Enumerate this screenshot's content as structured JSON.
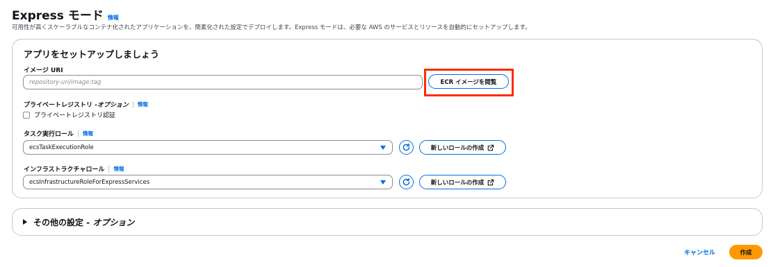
{
  "header": {
    "title": "Express モード",
    "info_label": "情報",
    "description": "可用性が高くスケーラブルなコンテナ化されたアプリケーションを、簡素化された設定でデプロイします。Express モードは、必要な AWS のサービスとリソースを自動的にセットアップします。"
  },
  "setup": {
    "title": "アプリをセットアップしましょう",
    "image_uri": {
      "label": "イメージ URI",
      "placeholder": "repository-uri/image:tag",
      "browse_button": "ECR イメージを閲覧"
    },
    "private_registry": {
      "label": "プライベートレジストリ - ",
      "label_optional": "オプション",
      "info_label": "情報",
      "checkbox_label": "プライベートレジストリ認証"
    },
    "task_execution_role": {
      "label": "タスク実行ロール",
      "info_label": "情報",
      "value": "ecsTaskExecutionRole",
      "create_button": "新しいロールの作成"
    },
    "infrastructure_role": {
      "label": "インフラストラクチャロール",
      "info_label": "情報",
      "value": "ecsInfrastructureRoleForExpressServices",
      "create_button": "新しいロールの作成"
    }
  },
  "other_settings": {
    "title": "その他の設定 - ",
    "title_optional": "オプション"
  },
  "footer": {
    "cancel_label": "キャンセル",
    "create_label": "作成"
  },
  "colors": {
    "accent": "#006ce0",
    "primary_button": "#ff9900",
    "highlight": "#ff2a00"
  }
}
